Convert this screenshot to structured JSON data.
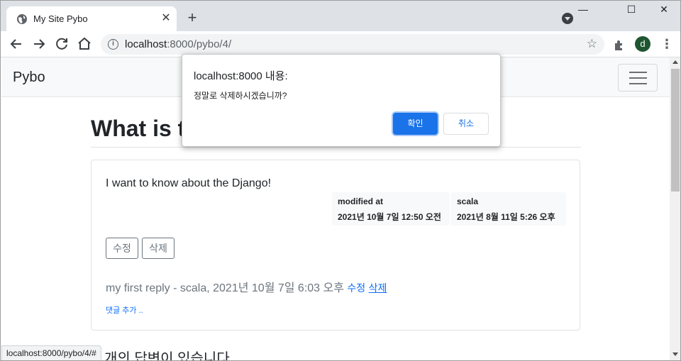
{
  "browser": {
    "tab_title": "My Site Pybo",
    "tab_close": "✕",
    "new_tab": "+",
    "url_host": "localhost",
    "url_rest": ":8000/pybo/4/",
    "profile_initial": "d",
    "window_minimize": "—",
    "window_maximize": "☐",
    "window_close": "✕",
    "status_url": "localhost:8000/pybo/4/#"
  },
  "navbar": {
    "brand": "Pybo"
  },
  "question": {
    "title_visible": "What is t",
    "content": "I want to know about the Django!",
    "modified_label": "modified at",
    "modified_value": "2021년 10월 7일 12:50 오전",
    "author_label": "scala",
    "author_value": "2021년 8월 11일 5:26 오후",
    "edit_button": "수정",
    "delete_button": "삭제"
  },
  "comment": {
    "text": "my first reply - scala, 2021년 10월 7일 6:03 오후",
    "edit_link": "수정",
    "delete_link": "삭제",
    "add_comment": "댓글 추가 .."
  },
  "answers_heading_visible": "개의 답변이 있습니다.",
  "dialog": {
    "title": "localhost:8000 내용:",
    "message": "정말로 삭제하시겠습니까?",
    "ok_label": "확인",
    "cancel_label": "취소"
  },
  "colors": {
    "accent": "#1a73e8",
    "link": "#0d6efd",
    "muted": "#6c757d"
  }
}
